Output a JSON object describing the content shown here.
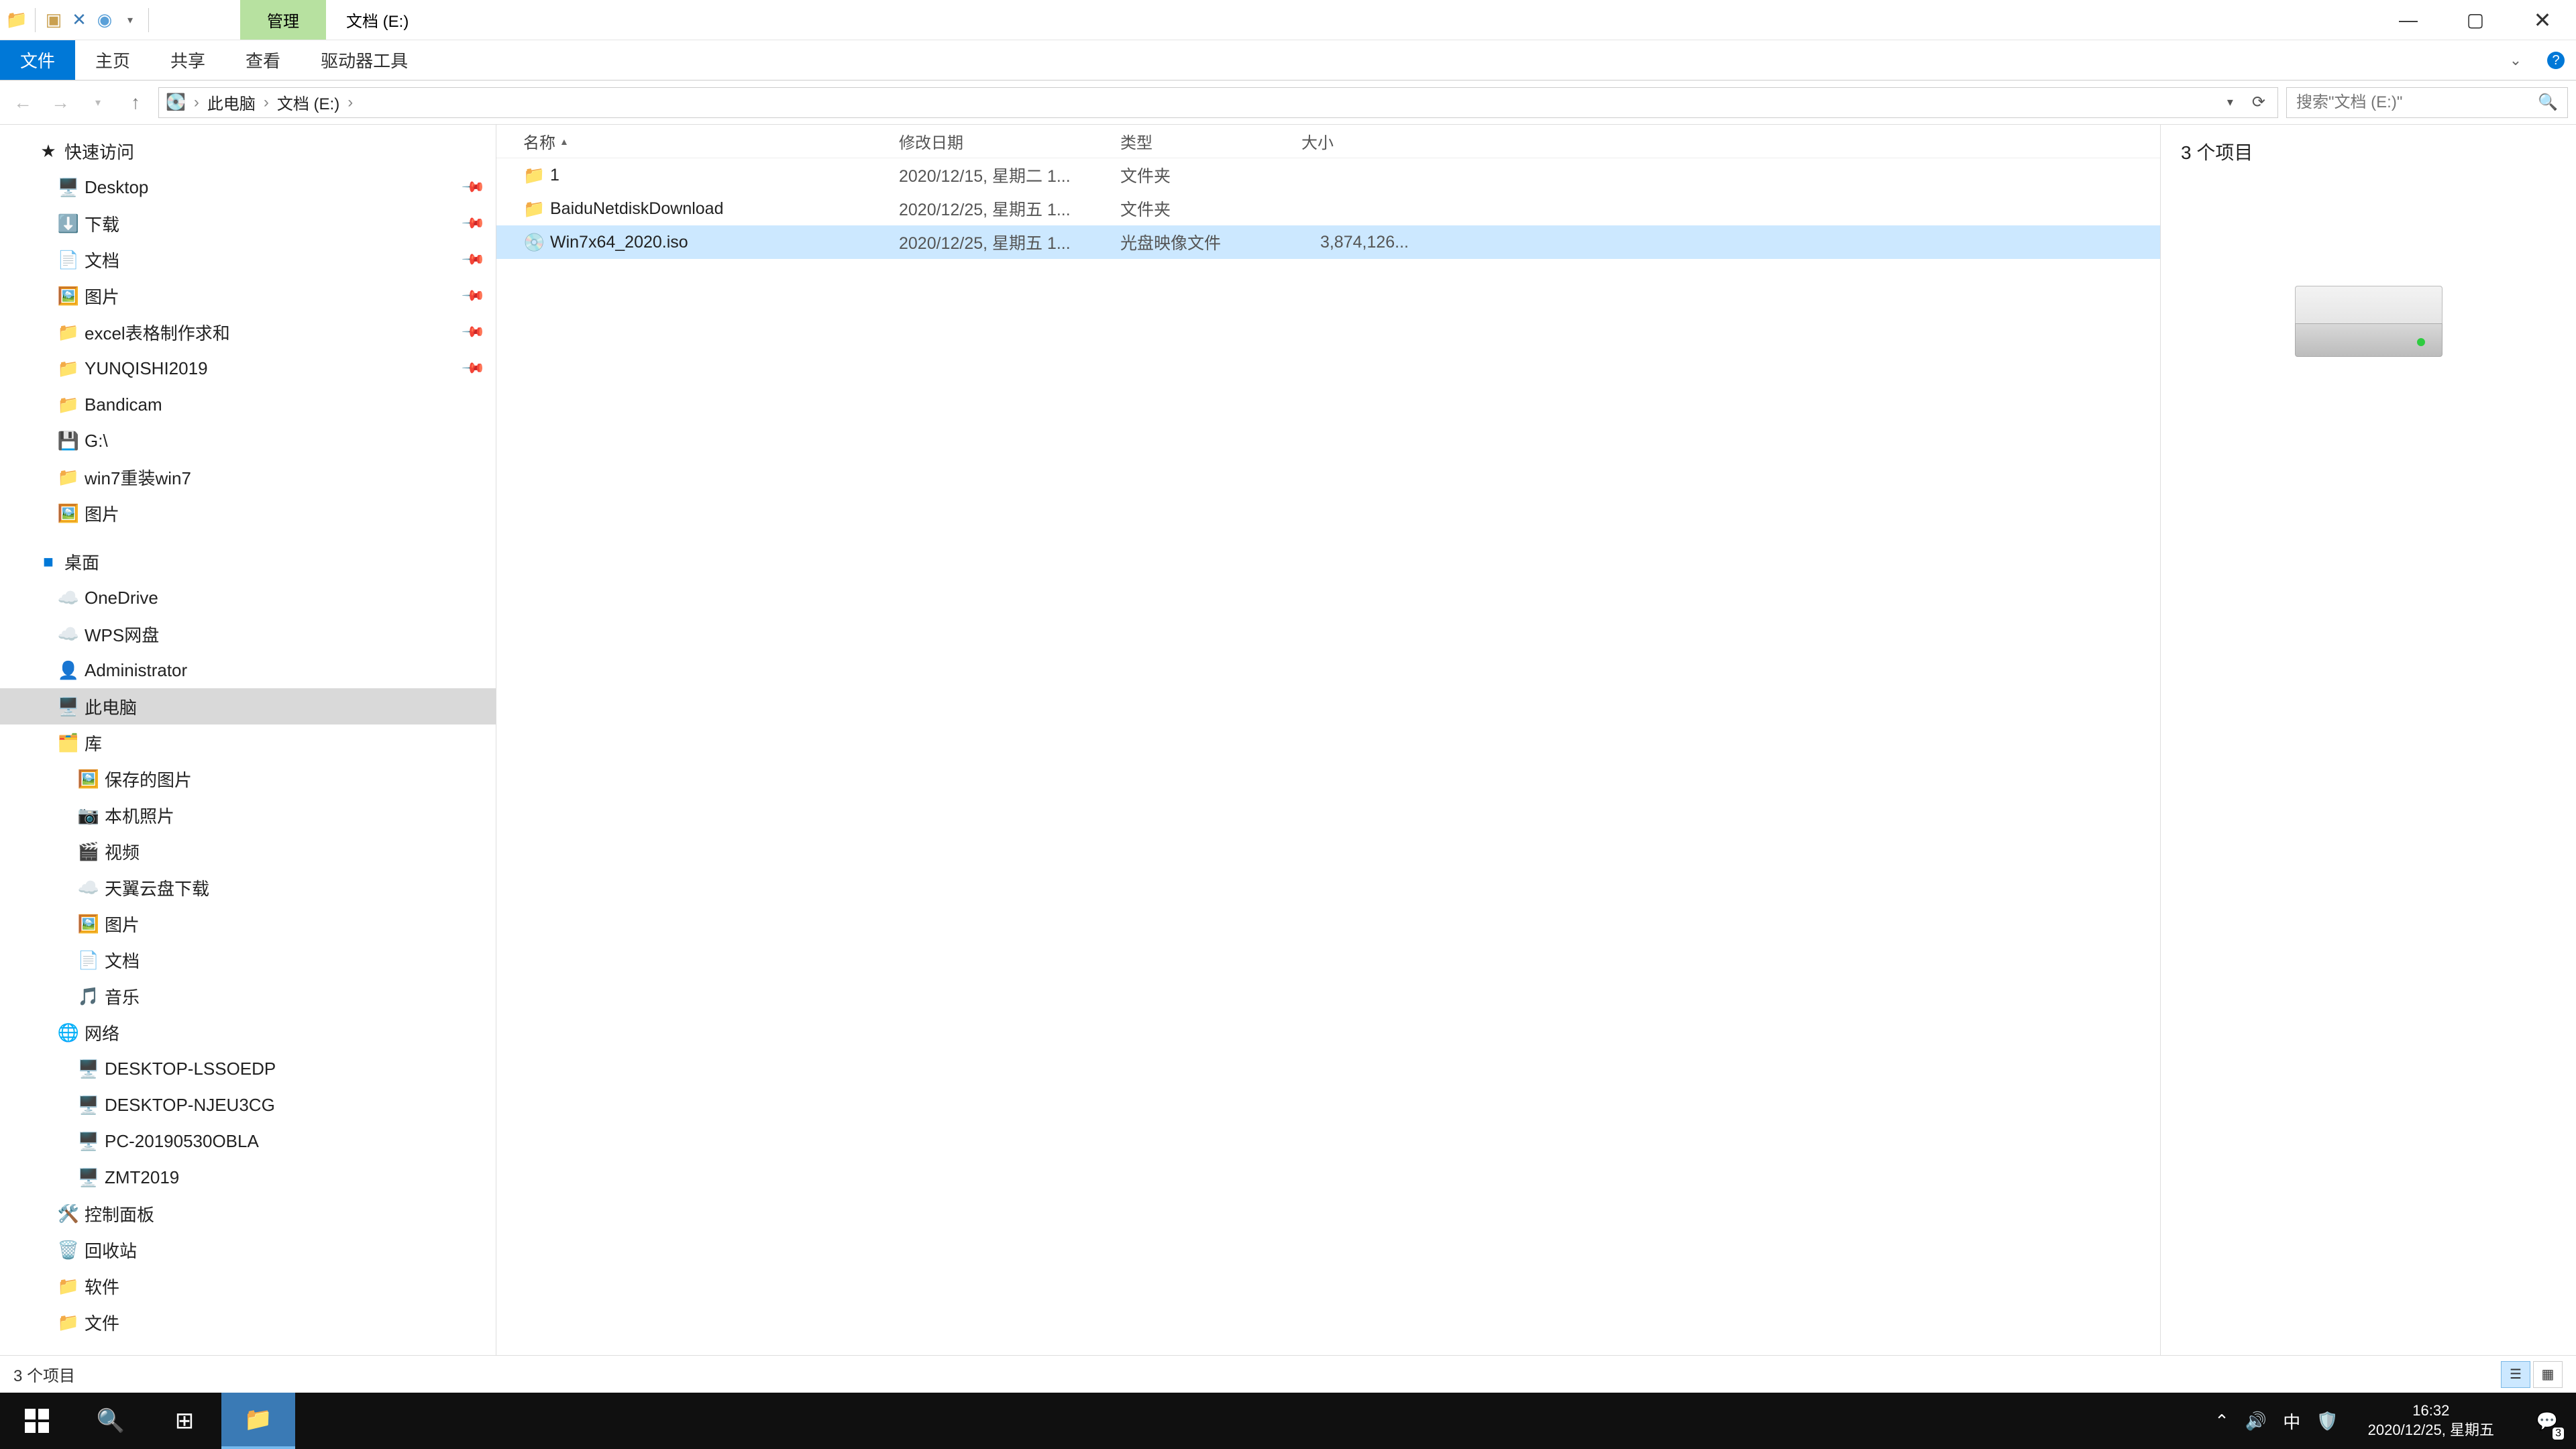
{
  "title_context": "管理",
  "window_title": "文档 (E:)",
  "ribbon": {
    "file": "文件",
    "home": "主页",
    "share": "共享",
    "view": "查看",
    "drive": "驱动器工具"
  },
  "breadcrumb": {
    "root": "此电脑",
    "loc": "文档 (E:)"
  },
  "search_placeholder": "搜索\"文档 (E:)\"",
  "columns": {
    "name": "名称",
    "date": "修改日期",
    "type": "类型",
    "size": "大小"
  },
  "files": [
    {
      "icon": "📁",
      "name": "1",
      "date": "2020/12/15, 星期二 1...",
      "type": "文件夹",
      "size": ""
    },
    {
      "icon": "📁",
      "name": "BaiduNetdiskDownload",
      "date": "2020/12/25, 星期五 1...",
      "type": "文件夹",
      "size": ""
    },
    {
      "icon": "💿",
      "name": "Win7x64_2020.iso",
      "date": "2020/12/25, 星期五 1...",
      "type": "光盘映像文件",
      "size": "3,874,126..."
    }
  ],
  "selected_file_index": 2,
  "nav": {
    "quick": "快速访问",
    "quick_items": [
      {
        "ico": "🖥️",
        "label": "Desktop",
        "pin": true
      },
      {
        "ico": "⬇️",
        "label": "下载",
        "pin": true
      },
      {
        "ico": "📄",
        "label": "文档",
        "pin": true
      },
      {
        "ico": "🖼️",
        "label": "图片",
        "pin": true
      },
      {
        "ico": "📁",
        "label": "excel表格制作求和",
        "pin": true
      },
      {
        "ico": "📁",
        "label": "YUNQISHI2019",
        "pin": true
      },
      {
        "ico": "📁",
        "label": "Bandicam",
        "pin": false
      },
      {
        "ico": "💾",
        "label": "G:\\",
        "pin": false
      },
      {
        "ico": "📁",
        "label": "win7重装win7",
        "pin": false
      },
      {
        "ico": "🖼️",
        "label": "图片",
        "pin": false
      }
    ],
    "desktop": "桌面",
    "desktop_items": [
      {
        "ico": "☁️",
        "label": "OneDrive"
      },
      {
        "ico": "☁️",
        "label": "WPS网盘"
      },
      {
        "ico": "👤",
        "label": "Administrator"
      }
    ],
    "thispc": "此电脑",
    "libs": "库",
    "lib_items": [
      {
        "ico": "🖼️",
        "label": "保存的图片"
      },
      {
        "ico": "📷",
        "label": "本机照片"
      },
      {
        "ico": "🎬",
        "label": "视频"
      },
      {
        "ico": "☁️",
        "label": "天翼云盘下载"
      },
      {
        "ico": "🖼️",
        "label": "图片"
      },
      {
        "ico": "📄",
        "label": "文档"
      },
      {
        "ico": "🎵",
        "label": "音乐"
      }
    ],
    "network": "网络",
    "net_items": [
      {
        "ico": "🖥️",
        "label": "DESKTOP-LSSOEDP"
      },
      {
        "ico": "🖥️",
        "label": "DESKTOP-NJEU3CG"
      },
      {
        "ico": "🖥️",
        "label": "PC-20190530OBLA"
      },
      {
        "ico": "🖥️",
        "label": "ZMT2019"
      }
    ],
    "ctrl": "控制面板",
    "recycle": "回收站",
    "soft": "软件",
    "docs": "文件"
  },
  "preview_count": "3 个项目",
  "status_text": "3 个项目",
  "tray": {
    "ime": "中",
    "time": "16:32",
    "date": "2020/12/25, 星期五",
    "notif_badge": "3"
  }
}
